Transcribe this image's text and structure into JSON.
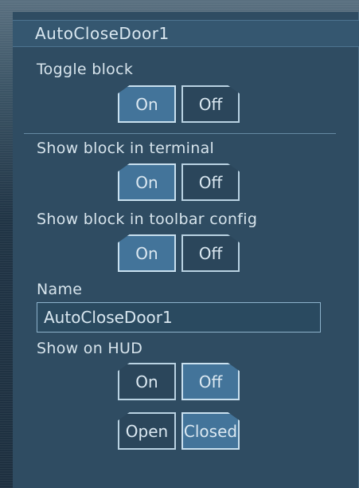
{
  "window": {
    "title": "AutoCloseDoor1"
  },
  "toggle_block": {
    "label": "Toggle block",
    "on": "On",
    "off": "Off",
    "active": "on"
  },
  "show_in_terminal": {
    "label": "Show block in terminal",
    "on": "On",
    "off": "Off",
    "active": "on"
  },
  "show_in_toolbar": {
    "label": "Show block in toolbar config",
    "on": "On",
    "off": "Off",
    "active": "on"
  },
  "name": {
    "label": "Name",
    "value": "AutoCloseDoor1"
  },
  "show_on_hud": {
    "label": "Show on HUD",
    "on": "On",
    "off": "Off",
    "active": "off"
  },
  "door_state": {
    "open": "Open",
    "closed": "Closed",
    "active": "closed"
  },
  "colors": {
    "panel": "#2f4c62",
    "accent": "#43749a",
    "border": "#b9d2e2",
    "text": "#d7e4ec"
  }
}
